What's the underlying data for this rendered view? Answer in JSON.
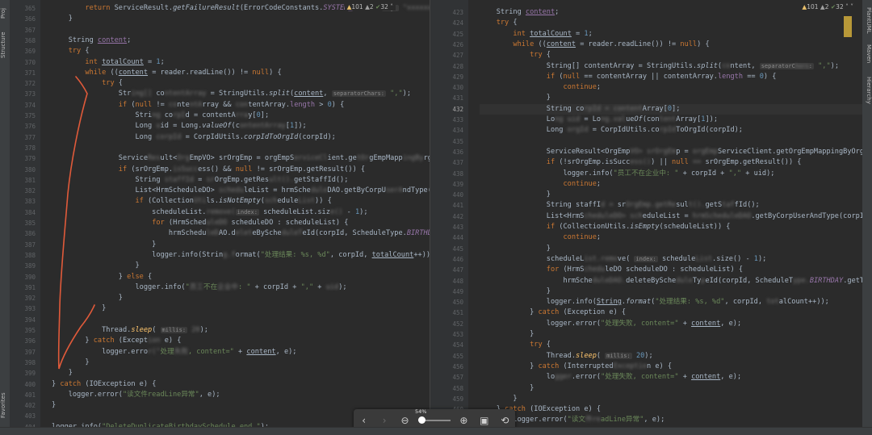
{
  "sidebar_left": {
    "structure_label": "Structure",
    "favorites_label": "Favorites",
    "project_label": "Proj"
  },
  "sidebar_right": {
    "plantuml_label": "PlantUML",
    "maven_label": "Maven",
    "hierarchy_label": "Hierarchy"
  },
  "left_pane": {
    "indicators": {
      "warnings": "101",
      "weak_warnings": "2",
      "ok": "32"
    },
    "lines": [
      {
        "n": "365",
        "html": "        <span class='kw'>return</span> ServiceResult.<span class='it'>getFailureResult</span>(ErrorCodeConstants.<span class='fld it'>SYSTEM_ERROR</span>, <span class='hint'>msg:</span> <span class='blur'>\"xxxxxx\"</span>"
      },
      {
        "n": "366",
        "html": "    }"
      },
      {
        "n": "367",
        "html": ""
      },
      {
        "n": "368",
        "html": "    String <span class='fld ul'>content</span>;"
      },
      {
        "n": "369",
        "html": "    <span class='kw'>try</span> {"
      },
      {
        "n": "370",
        "html": "        <span class='kw'>int</span> <span class='ul'>totalCount</span> = <span class='num'>1</span>;"
      },
      {
        "n": "371",
        "html": "        <span class='kw'>while</span> ((<span class='ul'>content</span> = reader.readLine()) != <span class='kw'>null</span>) {"
      },
      {
        "n": "372",
        "html": "            <span class='kw'>try</span> {"
      },
      {
        "n": "373",
        "html": "                Str<span class='blur'>ing[]</span> co<span class='blur'>ntentArray</span> = StringUtils.<span class='it'>split</span>(<span class='ul'>content</span>, <span class='hint'>separatorChars:</span> <span class='str'>\",\"</span>);"
      },
      {
        "n": "374",
        "html": "                <span class='kw'>if</span> (<span class='kw'>null</span> != <span class='blur'>co</span>nte<span class='blur'>ntA</span>rray &amp;&amp; <span class='blur'>con</span>tentArray.<span class='fld'>length</span> &gt; <span class='num'>0</span>) {"
      },
      {
        "n": "375",
        "html": "                    Stri<span class='blur'>ng</span> co<span class='blur'>rpI</span>d = contentA<span class='blur'>rra</span>y[<span class='num'>0</span>];"
      },
      {
        "n": "376",
        "html": "                    Long <span class='blur'>u</span>id = Long.<span class='it'>valueOf</span>(c<span class='blur'>ontentArray</span>[<span class='num'>1</span>]);"
      },
      {
        "n": "377",
        "html": "                    Long <span class='blur'>corpId</span> = CorpIdUtils.<span class='it'>corpIdToOrgId</span>(corpId);"
      },
      {
        "n": "378",
        "html": ""
      },
      {
        "n": "379",
        "html": "                Service<span class='blur'>Res</span>ult&lt;<span class='blur'>Org</span>EmpVO&gt; srOrgEmp = orgEmpS<span class='blur'>erviceCl</span>ient.ge<span class='blur'>tOr</span>gEmpMapp<span class='blur'>ingBy</span>rgIdAndUid"
      },
      {
        "n": "380",
        "html": "                <span class='kw'>if</span> (srOrgEmp.<span class='blur'>isSucc</span>ess() &amp;&amp; <span class='kw'>null</span> != srOrgEmp.getResult()) {"
      },
      {
        "n": "381",
        "html": "                    String <span class='blur'>staffId</span> = <span class='blur'>sr</span>OrgEmp.getRes<span class='blur'>ult().</span>getStaffId();"
      },
      {
        "n": "382",
        "html": "                    List&lt;HrmScheduleDO&gt; <span class='blur'>schedu</span>leList = hrmSche<span class='blur'>dule</span>DAO.getByCorpU<span class='blur'>serA</span>ndType(corpId, s"
      },
      {
        "n": "383",
        "html": "                    <span class='kw'>if</span> (Collection<span class='blur'>Uti</span>ls.<span class='it'>isNotEmpty</span>(<span class='blur'>sch</span>edule<span class='blur'>List</span>)) {"
      },
      {
        "n": "384",
        "html": "                        scheduleList.<span class='blur'>remove(</span><span class='hint'>index:</span> scheduleList.siz<span class='blur'>e()</span> - <span class='num'>1</span>);"
      },
      {
        "n": "385",
        "html": "                        <span class='kw'>for</span> (HrmSched<span class='blur'>uleDO</span> scheduleDO : scheduleList) {"
      },
      {
        "n": "386",
        "html": "                            hrmSchedu<span class='blur'>leD</span>AO.d<span class='blur'>elet</span>eBySche<span class='blur'>duleT</span>eId(corpId, ScheduleType.<span class='fld it'>BIRTHDAY</span>.getT"
      },
      {
        "n": "387",
        "html": "                        }"
      },
      {
        "n": "388",
        "html": "                        logger.info(Strin<span class='blur'>g.f</span>ormat(<span class='str'>\"处理结果: %s, %d\"</span>, corpId, <span class='ul'>totalCount</span>++));"
      },
      {
        "n": "389",
        "html": "                    }"
      },
      {
        "n": "390",
        "html": "                } <span class='kw'>else</span> {"
      },
      {
        "n": "391",
        "html": "                    logger.info(<span class='str'>\"<span class='blur'>员工</span>不在<span class='blur'>企业中</span>: \"</span> + corpId + <span class='str'>\",\"</span> + <span class='blur'>uid</span>);"
      },
      {
        "n": "392",
        "html": "                }"
      },
      {
        "n": "393",
        "html": "            }"
      },
      {
        "n": "394",
        "html": ""
      },
      {
        "n": "395",
        "html": "            Thread.<span class='fn it'>sleep</span>( <span class='hint'>millis:</span> <span class='blur'>20</span>);"
      },
      {
        "n": "396",
        "html": "        } <span class='kw'>catch</span> (Except<span class='blur'>ion</span> e) {"
      },
      {
        "n": "397",
        "html": "            logger.erro<span class='blur'>r(\"</span><span class='str'>处理<span class='blur'>失败</span>, content=\"</span> + <span class='ul'>content</span>, e);"
      },
      {
        "n": "398",
        "html": "        }"
      },
      {
        "n": "399",
        "html": "    }"
      },
      {
        "n": "400",
        "html": "} <span class='kw'>catch</span> (IOException e) {"
      },
      {
        "n": "401",
        "html": "    logger.error(<span class='str'>\"读文件readLine异常\"</span>, e);"
      },
      {
        "n": "402",
        "html": "}"
      },
      {
        "n": "403",
        "html": ""
      },
      {
        "n": "404",
        "html": "logger.info(<span class='str'>\"DeleteDuplicateBirthdaySchedule end.\"</span>);"
      }
    ]
  },
  "right_pane": {
    "indicators": {
      "warnings": "101",
      "weak_warnings": "2",
      "ok": "32"
    },
    "lines": [
      {
        "n": "423",
        "html": "    String <span class='fld ul'>content</span>;"
      },
      {
        "n": "424",
        "html": "    <span class='kw'>try</span> {"
      },
      {
        "n": "425",
        "html": "        <span class='kw'>int</span> <span class='ul'>totalCount</span> = <span class='num'>1</span>;"
      },
      {
        "n": "426",
        "html": "        <span class='kw'>while</span> ((<span class='ul'>content</span> = reader.readLine()) != <span class='kw'>null</span>) {"
      },
      {
        "n": "427",
        "html": "            <span class='kw'>try</span> {"
      },
      {
        "n": "428",
        "html": "                String[] contentArray = StringUtils.<span class='it'>split</span>(<span class='blur'>co</span>ntent, <span class='hint'>separatorC<span class='blur'>hars</span>:</span> <span class='str'>\",\"</span>);"
      },
      {
        "n": "429",
        "html": "                <span class='kw'>if</span> (<span class='kw'>null</span> == contentArray || contentArray.<span class='fld'>length</span> == <span class='num'>0</span>) {"
      },
      {
        "n": "430",
        "html": "                    <span class='kw'>continue</span>;"
      },
      {
        "n": "431",
        "html": "                }"
      },
      {
        "n": "432",
        "html": "                String co<span class='blur'>rpId = content</span>Array[<span class='num'>0</span>];",
        "cur": true
      },
      {
        "n": "433",
        "html": "                Lo<span class='blur'>ng uid</span> = Lo<span class='blur'>ng.val</span>ue<span class='it'>Of</span>(con<span class='blur'>tent</span>Array[<span class='num'>1</span>]);"
      },
      {
        "n": "434",
        "html": "                Long <span class='blur'>orgId</span> = CorpIdUtils.co<span class='blur'>rpId</span>ToOrgId(corpId);"
      },
      {
        "n": "435",
        "html": ""
      },
      {
        "n": "436",
        "html": "                ServiceResult&lt;OrgEmp<span class='blur'>VO&gt; srOrgEm</span>p = <span class='blur'>orgEmp</span>ServiceClient.getOrgEmpMappingByOrgIdA"
      },
      {
        "n": "437",
        "html": "                <span class='kw'>if</span> (!srOrgEmp.isSucc<span class='blur'>ess()</span>) || <span class='kw'>null</span> <span class='blur'>==</span> srOrgEmp.getResult()) {"
      },
      {
        "n": "438",
        "html": "                    logger.info(<span class='str'>\"员工不在企业中: \"</span> + corpId + <span class='str'>\",\"</span> + uid);"
      },
      {
        "n": "439",
        "html": "                    <span class='kw'>continue</span>;"
      },
      {
        "n": "440",
        "html": "                }"
      },
      {
        "n": "441",
        "html": "                String staffI<span class='blur'>d =</span> sr<span class='blur'>OrgEmp.getRe</span>sul<span class='blur'>t().</span>getS<span class='blur'>taf</span>fId();"
      },
      {
        "n": "442",
        "html": "                List&lt;HrmS<span class='blur'>cheduleDO&gt; sch</span>eduleList = <span class='blur'>hrmScheduleDAO</span>.getByCorpUserAndType(corpId, s"
      },
      {
        "n": "443",
        "html": "                <span class='kw'>if</span> (CollectionUtils.<span class='it'>isEmpty</span>(scheduleList)) {"
      },
      {
        "n": "444",
        "html": "                    <span class='kw'>continue</span>;"
      },
      {
        "n": "445",
        "html": "                }"
      },
      {
        "n": "446",
        "html": "                scheduleL<span class='blur'>ist.remo</span>ve( <span class='hint'>index:</span> schedule<span class='blur'>List</span>.size() - <span class='num'>1</span>);"
      },
      {
        "n": "447",
        "html": "                <span class='kw'>for</span> (HrmS<span class='blur'>chedu</span>leDO scheduleDO : scheduleList) {"
      },
      {
        "n": "448",
        "html": "                    hrmSche<span class='blur'>duleDAO.</span>deleteBySche<span class='blur'>dule</span>Ty<span class='blur'>p</span>eId(corpId, ScheduleT<span class='blur'>ype.</span><span class='fld it'>BIRTHDAY</span>.getType("
      },
      {
        "n": "449",
        "html": "                }"
      },
      {
        "n": "450",
        "html": "                logger.info(<span class='ul'>String</span>.<span class='it'>format</span>(<span class='str'>\"处理结果: %s, %d\"</span>, corpId, <span class='blur'>tot</span>alCount++));"
      },
      {
        "n": "451",
        "html": "            } <span class='kw'>catch</span> (Exception e) {"
      },
      {
        "n": "452",
        "html": "                logger.error(<span class='str'>\"处理失败, content=\"</span> + <span class='ul'>content</span>, e);"
      },
      {
        "n": "453",
        "html": "            }"
      },
      {
        "n": "454",
        "html": "            <span class='kw'>try</span> {"
      },
      {
        "n": "455",
        "html": "                Thread.<span class='fn it'>sleep</span>( <span class='hint'>millis:</span> <span class='num'>20</span>);"
      },
      {
        "n": "456",
        "html": "            } <span class='kw'>catch</span> (Interrupted<span class='blur'>Exceptio</span>n e) {"
      },
      {
        "n": "457",
        "html": "                lo<span class='blur'>gger</span>.error(<span class='str'>\"处理失败, content=\"</span> + <span class='ul'>content</span>, e);"
      },
      {
        "n": "458",
        "html": "            }"
      },
      {
        "n": "459",
        "html": "        }"
      },
      {
        "n": "460",
        "html": "    } <span class='kw'>catch</span> (IOException e) {"
      },
      {
        "n": "461",
        "html": "        logger.error(<span class='str'>\"读文<span class='blur'>件re</span>adLine异常\"</span>, e);"
      }
    ]
  },
  "zoombar": {
    "zoom_level": "54%",
    "back": "‹",
    "forward": "›",
    "zoom_out": "⊖",
    "zoom_in": "⊕",
    "fit": "▣",
    "rotate": "⟲"
  },
  "colors": {
    "annotation_stroke": "#e05a3a",
    "warning": "#e8bf6a",
    "keyword": "#cc7832",
    "string": "#6a8759"
  }
}
